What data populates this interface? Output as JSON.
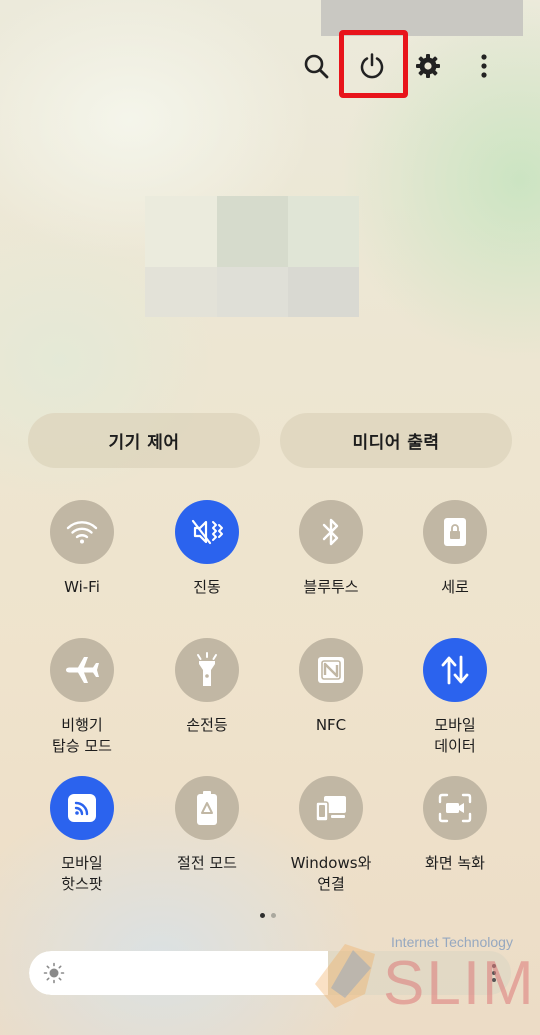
{
  "header": {
    "icons": [
      "search-icon",
      "power-icon",
      "settings-gear-icon",
      "more-vert-icon"
    ]
  },
  "pills": {
    "device_control": "기기 제어",
    "media_output": "미디어 출력"
  },
  "tiles": [
    {
      "label": "Wi-Fi",
      "icon": "wifi-icon",
      "active": false
    },
    {
      "label": "진동",
      "icon": "vibrate-icon",
      "active": true
    },
    {
      "label": "블루투스",
      "icon": "bluetooth-icon",
      "active": false
    },
    {
      "label": "세로",
      "icon": "portrait-lock-icon",
      "active": false
    },
    {
      "label": "비행기\n탑승 모드",
      "icon": "airplane-icon",
      "active": false
    },
    {
      "label": "손전등",
      "icon": "flashlight-icon",
      "active": false
    },
    {
      "label": "NFC",
      "icon": "nfc-icon",
      "active": false
    },
    {
      "label": "모바일\n데이터",
      "icon": "mobile-data-icon",
      "active": true
    },
    {
      "label": "모바일\n핫스팟",
      "icon": "hotspot-icon",
      "active": true
    },
    {
      "label": "절전 모드",
      "icon": "power-saving-icon",
      "active": false
    },
    {
      "label": "Windows와\n연결",
      "icon": "link-windows-icon",
      "active": false
    },
    {
      "label": "화면 녹화",
      "icon": "screen-record-icon",
      "active": false
    }
  ],
  "pager": {
    "pages": 2,
    "current": 1
  },
  "brightness": {
    "level": 0.62
  },
  "watermark": {
    "top": "Internet Technology",
    "main": "SLIM"
  },
  "colors": {
    "active": "#2b63ee",
    "inactive": "#c1b7a4",
    "highlight": "#e8141b"
  }
}
